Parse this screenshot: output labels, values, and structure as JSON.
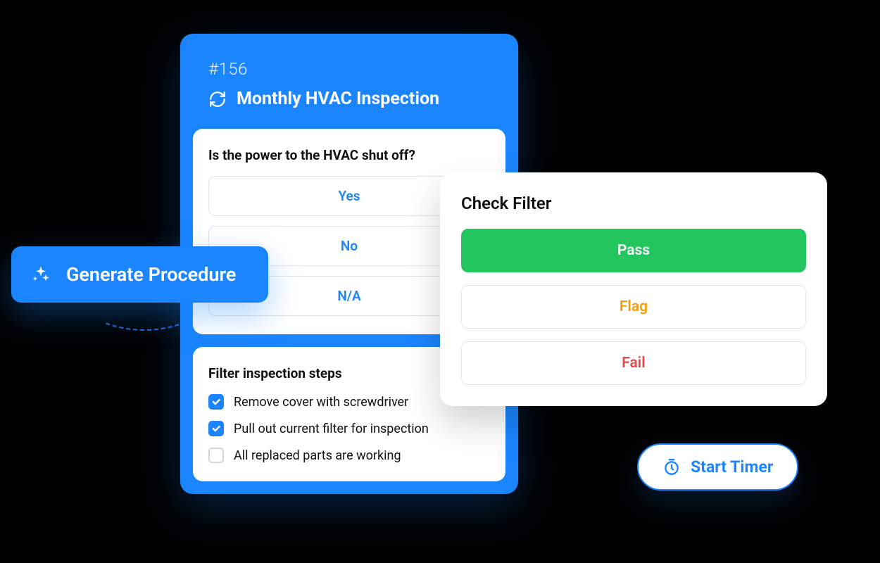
{
  "card": {
    "id": "#156",
    "title": "Monthly HVAC Inspection"
  },
  "question1": {
    "title": "Is the power to the HVAC shut off?",
    "options": [
      "Yes",
      "No",
      "N/A"
    ]
  },
  "checklist": {
    "title": "Filter inspection steps",
    "items": [
      {
        "label": "Remove cover with screwdriver",
        "checked": true
      },
      {
        "label": "Pull out current filter for inspection",
        "checked": true
      },
      {
        "label": "All replaced parts are working",
        "checked": false
      }
    ]
  },
  "filter": {
    "title": "Check Filter",
    "options": {
      "pass": "Pass",
      "flag": "Flag",
      "fail": "Fail"
    }
  },
  "generate_label": "Generate Procedure",
  "timer_label": "Start Timer"
}
